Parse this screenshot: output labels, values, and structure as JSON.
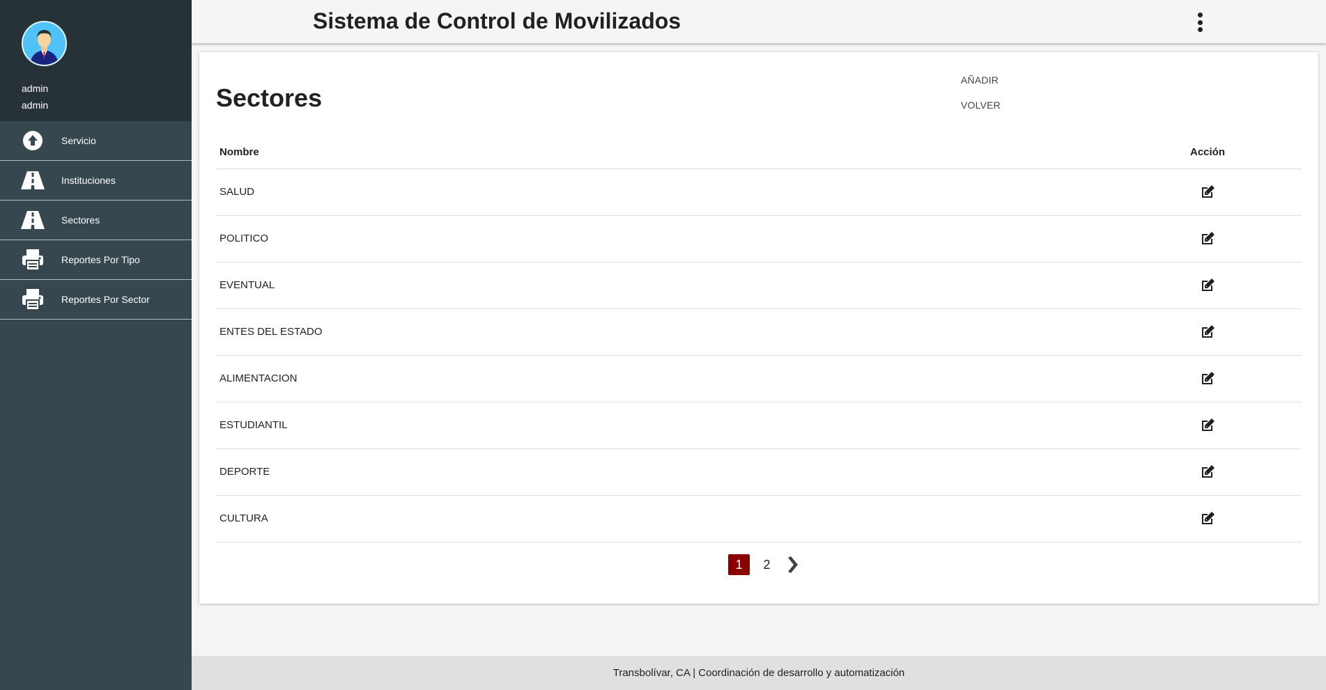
{
  "app": {
    "title": "Sistema de Control de Movilizados"
  },
  "user": {
    "name": "admin",
    "role": "admin"
  },
  "sidebar": {
    "items": [
      {
        "label": "Servicio",
        "icon": "upload-circle-icon"
      },
      {
        "label": "Instituciones",
        "icon": "road-icon"
      },
      {
        "label": "Sectores",
        "icon": "road-icon"
      },
      {
        "label": "Reportes Por Tipo",
        "icon": "printer-icon"
      },
      {
        "label": "Reportes Por Sector",
        "icon": "printer-icon"
      }
    ]
  },
  "main": {
    "title": "Sectores",
    "add_label": "AÑADIR",
    "back_label": "VOLVER",
    "table": {
      "headers": {
        "name": "Nombre",
        "action": "Acción"
      },
      "rows": [
        {
          "name": "SALUD"
        },
        {
          "name": "POLITICO"
        },
        {
          "name": "EVENTUAL"
        },
        {
          "name": "ENTES DEL ESTADO"
        },
        {
          "name": "ALIMENTACION"
        },
        {
          "name": "ESTUDIANTIL"
        },
        {
          "name": "DEPORTE"
        },
        {
          "name": "CULTURA"
        }
      ]
    },
    "pagination": {
      "pages": [
        "1",
        "2"
      ],
      "current": "1"
    }
  },
  "footer": {
    "text": "Transbolívar, CA | Coordinación de desarrollo y automatización"
  },
  "colors": {
    "sidebar": "#37474f",
    "sidebar_top": "#263238",
    "accent": "#8b0000"
  }
}
